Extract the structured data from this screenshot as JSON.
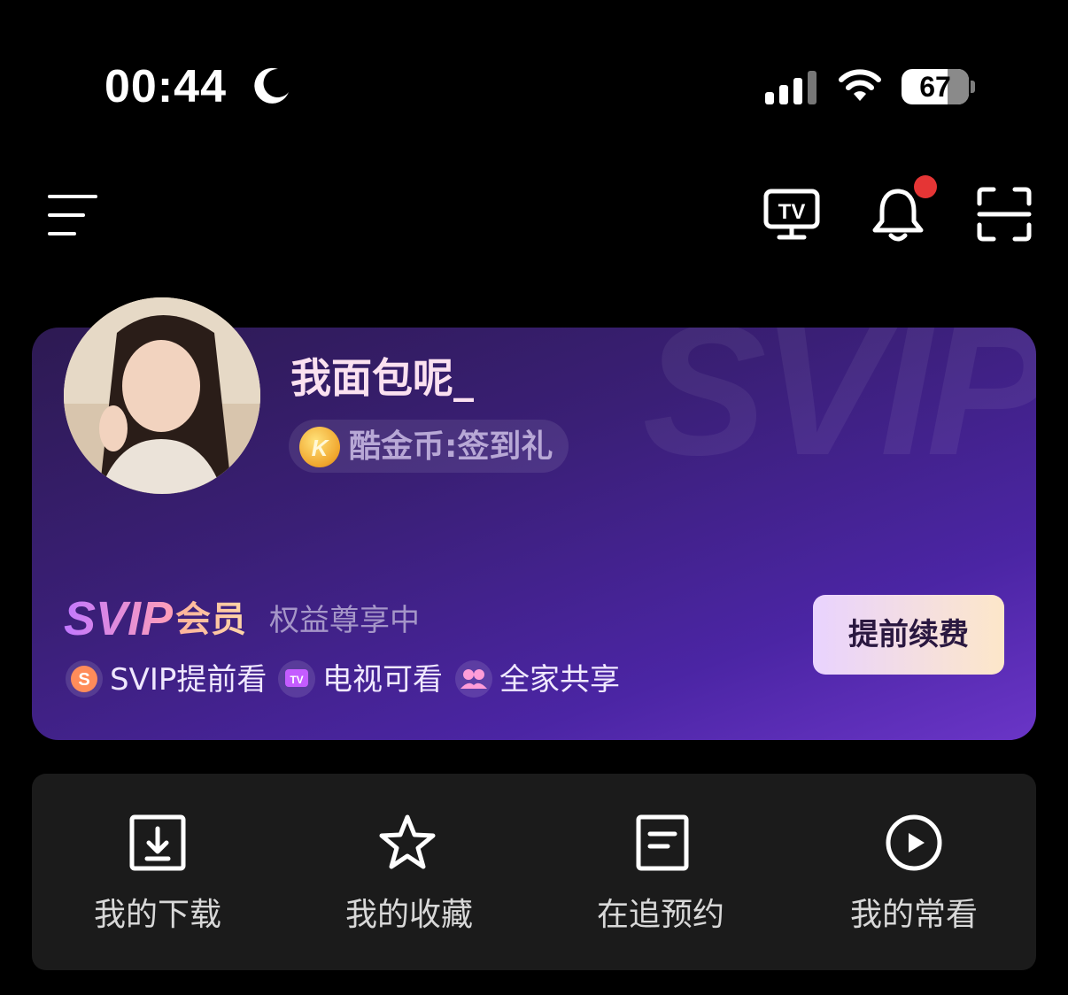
{
  "status_bar": {
    "time": "00:44",
    "battery_level": "67",
    "icons": [
      "moon-icon",
      "signal-icon",
      "wifi-icon",
      "battery-icon"
    ]
  },
  "top_bar": {
    "icons": [
      "menu-icon",
      "tv-icon",
      "bell-icon",
      "scan-icon"
    ],
    "notification_dot_color": "#e53535"
  },
  "profile": {
    "username": "我面包呢_",
    "coin_label": "酷金币:签到礼",
    "card_watermark": "SVIP"
  },
  "membership": {
    "tier": "SVIP",
    "tier_suffix": "会员",
    "status": "权益尊享中",
    "renew_button": "提前续费",
    "benefits": [
      {
        "icon": "svip-badge-icon",
        "label": "SVIP提前看"
      },
      {
        "icon": "tv-badge-icon",
        "label": "电视可看"
      },
      {
        "icon": "family-icon",
        "label": "全家共享"
      }
    ]
  },
  "quick_actions": [
    {
      "icon": "download-icon",
      "label": "我的下载"
    },
    {
      "icon": "star-icon",
      "label": "我的收藏"
    },
    {
      "icon": "reservation-icon",
      "label": "在追预约"
    },
    {
      "icon": "play-icon",
      "label": "我的常看"
    }
  ],
  "colors": {
    "accent_purple": "#4b25a4",
    "renew_button_gradient_start": "#e9d3ff",
    "renew_button_gradient_end": "#fde7c9"
  }
}
